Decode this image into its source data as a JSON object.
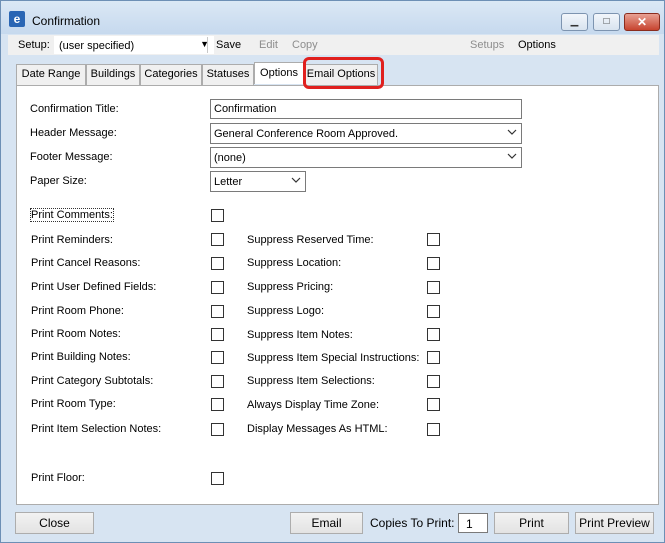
{
  "window": {
    "title": "Confirmation",
    "min_glyph": "▁",
    "max_glyph": "□",
    "close_glyph": "✕"
  },
  "toolbar": {
    "setup_label": "Setup:",
    "setup_value": "(user specified)",
    "save_label": "Save",
    "edit_label": "Edit",
    "copy_label": "Copy",
    "setups_label": "Setups",
    "options_label": "Options"
  },
  "tabs": [
    {
      "label": "Date Range"
    },
    {
      "label": "Buildings"
    },
    {
      "label": "Categories"
    },
    {
      "label": "Statuses"
    },
    {
      "label": "Options"
    },
    {
      "label": "Email Options"
    }
  ],
  "active_tab": "Options",
  "highlighted_tab": "Email Options",
  "highlight_color": "#e0201e",
  "form": {
    "confirmation_title_label": "Confirmation Title:",
    "confirmation_title_value": "Confirmation",
    "header_message_label": "Header Message:",
    "header_message_value": "General Conference Room Approved.",
    "footer_message_label": "Footer Message:",
    "footer_message_value": "(none)",
    "paper_size_label": "Paper Size:",
    "paper_size_value": "Letter"
  },
  "left_checks": [
    {
      "label": "Print Comments:",
      "checked": false
    },
    {
      "label": "Print Reminders:",
      "checked": false
    },
    {
      "label": "Print Cancel Reasons:",
      "checked": false
    },
    {
      "label": "Print User Defined Fields:",
      "checked": false
    },
    {
      "label": "Print Room Phone:",
      "checked": false
    },
    {
      "label": "Print Room Notes:",
      "checked": false
    },
    {
      "label": "Print Building Notes:",
      "checked": false
    },
    {
      "label": "Print Category Subtotals:",
      "checked": false
    },
    {
      "label": "Print Room Type:",
      "checked": false
    },
    {
      "label": "Print Item Selection Notes:",
      "checked": false
    },
    {
      "label": "Print Floor:",
      "checked": false
    }
  ],
  "right_checks": [
    {
      "label": "Suppress Reserved Time:",
      "checked": false
    },
    {
      "label": "Suppress Location:",
      "checked": false
    },
    {
      "label": "Suppress Pricing:",
      "checked": false
    },
    {
      "label": "Suppress Logo:",
      "checked": false
    },
    {
      "label": "Suppress Item Notes:",
      "checked": false
    },
    {
      "label": "Suppress Item Special Instructions:",
      "checked": false
    },
    {
      "label": "Suppress Item Selections:",
      "checked": false
    },
    {
      "label": "Always Display Time Zone:",
      "checked": false
    },
    {
      "label": "Display Messages As HTML:",
      "checked": false
    }
  ],
  "bottom": {
    "close_label": "Close",
    "email_label": "Email",
    "copies_label": "Copies To Print:",
    "copies_value": "1",
    "print_label": "Print",
    "print_preview_label": "Print Preview"
  },
  "icons": {
    "app": "app-logo-icon",
    "dropdown": "chevron-down-icon"
  }
}
